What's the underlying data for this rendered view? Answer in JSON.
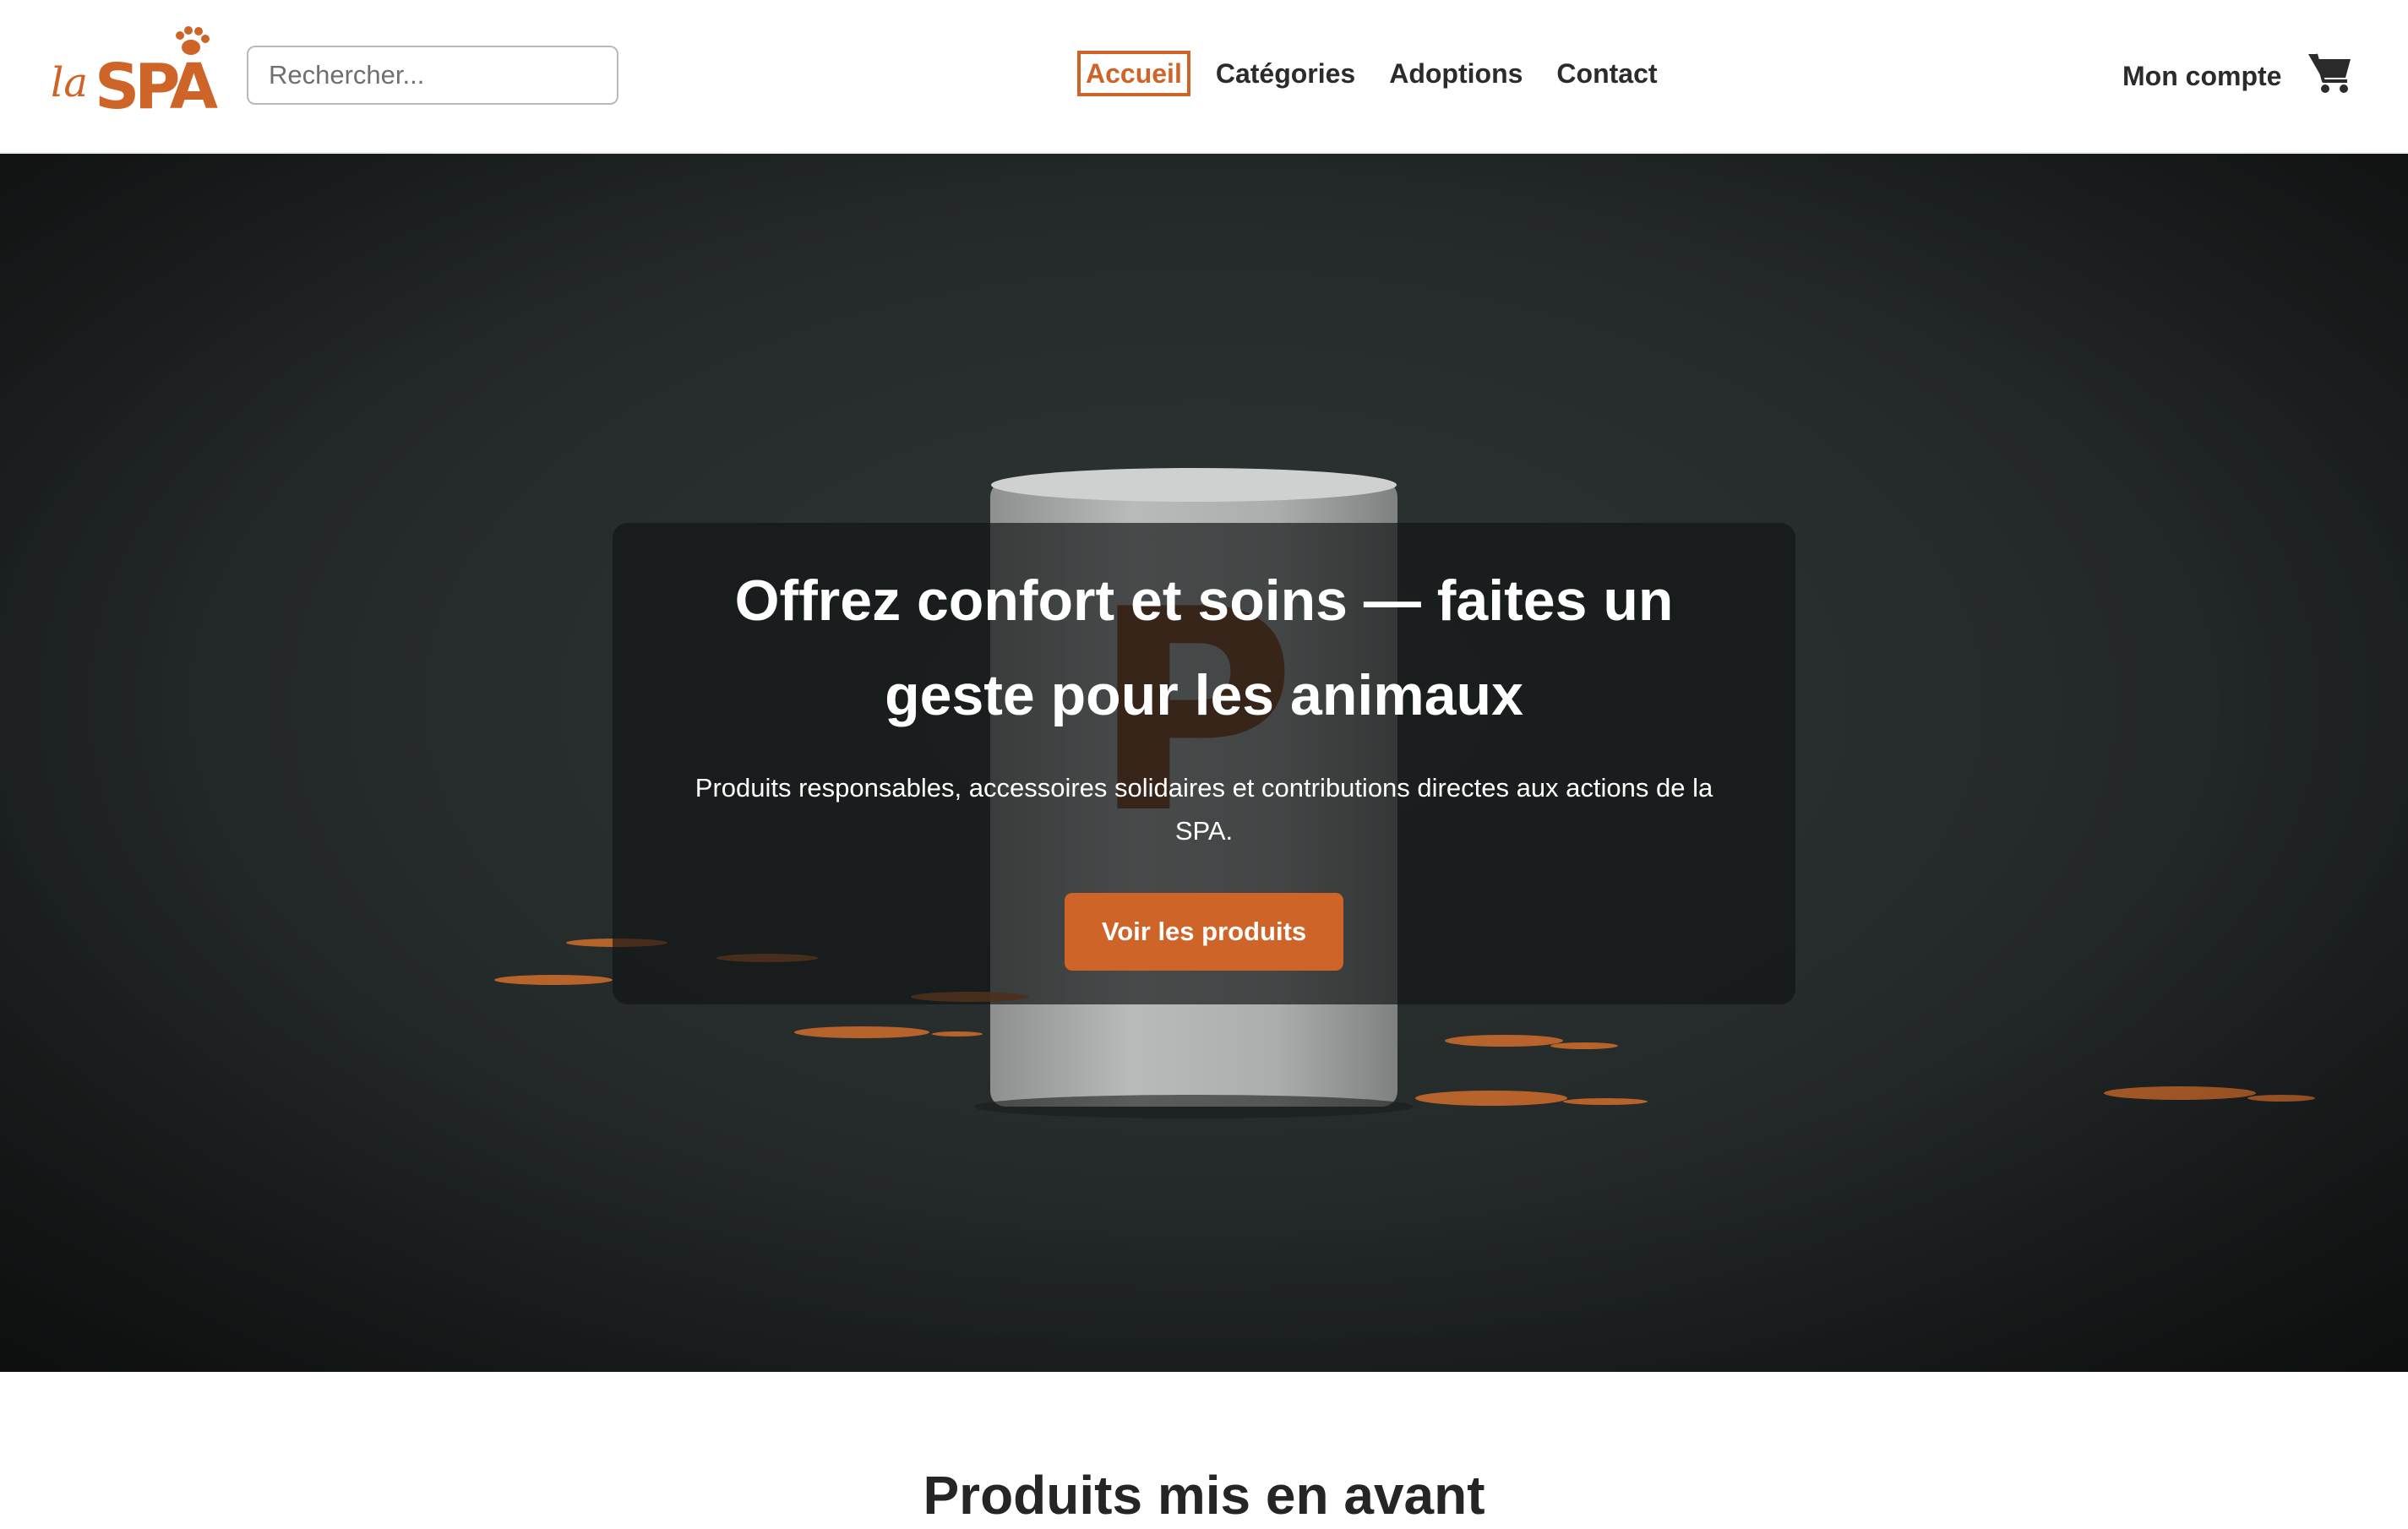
{
  "brand": {
    "logo_text_small": "la",
    "logo_text_big": "SPA",
    "accent": "#cf6428"
  },
  "search": {
    "placeholder": "Rechercher..."
  },
  "nav": {
    "items": [
      {
        "label": "Accueil",
        "active": true
      },
      {
        "label": "Catégories",
        "active": false
      },
      {
        "label": "Adoptions",
        "active": false
      },
      {
        "label": "Contact",
        "active": false
      }
    ]
  },
  "account": {
    "label": "Mon compte",
    "cart_icon": "cart-icon"
  },
  "hero": {
    "title": "Offrez confort et soins — faites un geste pour les animaux",
    "subtitle": "Produits responsables, accessoires solidaires et contributions directes aux actions de la SPA.",
    "cta_label": "Voir les produits",
    "mug_letter": "P"
  },
  "featured": {
    "title": "Produits mis en avant"
  }
}
